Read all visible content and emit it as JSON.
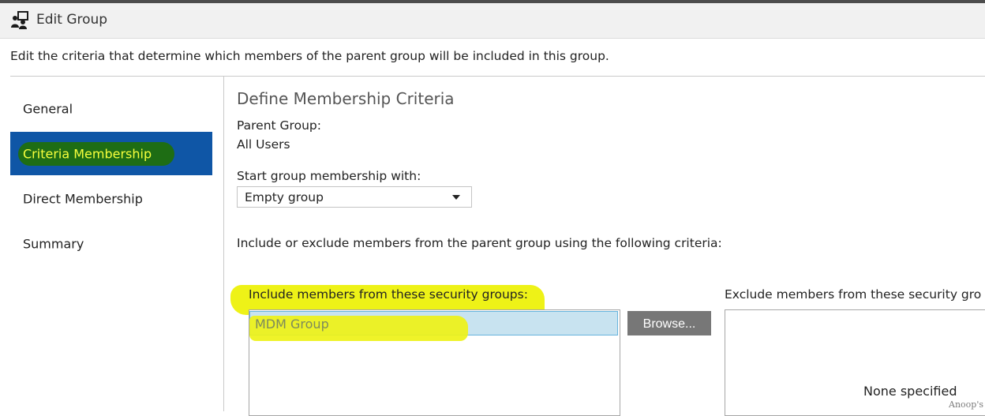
{
  "window": {
    "title": "Edit Group",
    "icon": "group-icon"
  },
  "description": "Edit the criteria that determine which members of the parent group will be included in this group.",
  "nav": {
    "items": [
      {
        "label": "General",
        "selected": false
      },
      {
        "label": "Criteria Membership",
        "selected": true
      },
      {
        "label": "Direct Membership",
        "selected": false
      },
      {
        "label": "Summary",
        "selected": false
      }
    ]
  },
  "content": {
    "section_title": "Define Membership Criteria",
    "parent_group_label": "Parent Group:",
    "parent_group_value": "All Users",
    "start_label": "Start group membership with:",
    "start_value": "Empty group",
    "criteria_intro": "Include or exclude members from the parent group using the following criteria:",
    "include_label": "Include members from these security groups:",
    "include_items": [
      "MDM Group"
    ],
    "browse_label": "Browse...",
    "exclude_label": "Exclude members from these security gro",
    "exclude_empty_text": "None specified"
  },
  "watermark": "Anoop's",
  "colors": {
    "nav_selected_bg": "#0f56a6",
    "nav_highlight": "#1e6d14",
    "nav_selected_text": "#f7ff3c",
    "annotation_yellow": "#eef217",
    "browse_button": "#777777",
    "list_selection": "#c8e3f0"
  }
}
